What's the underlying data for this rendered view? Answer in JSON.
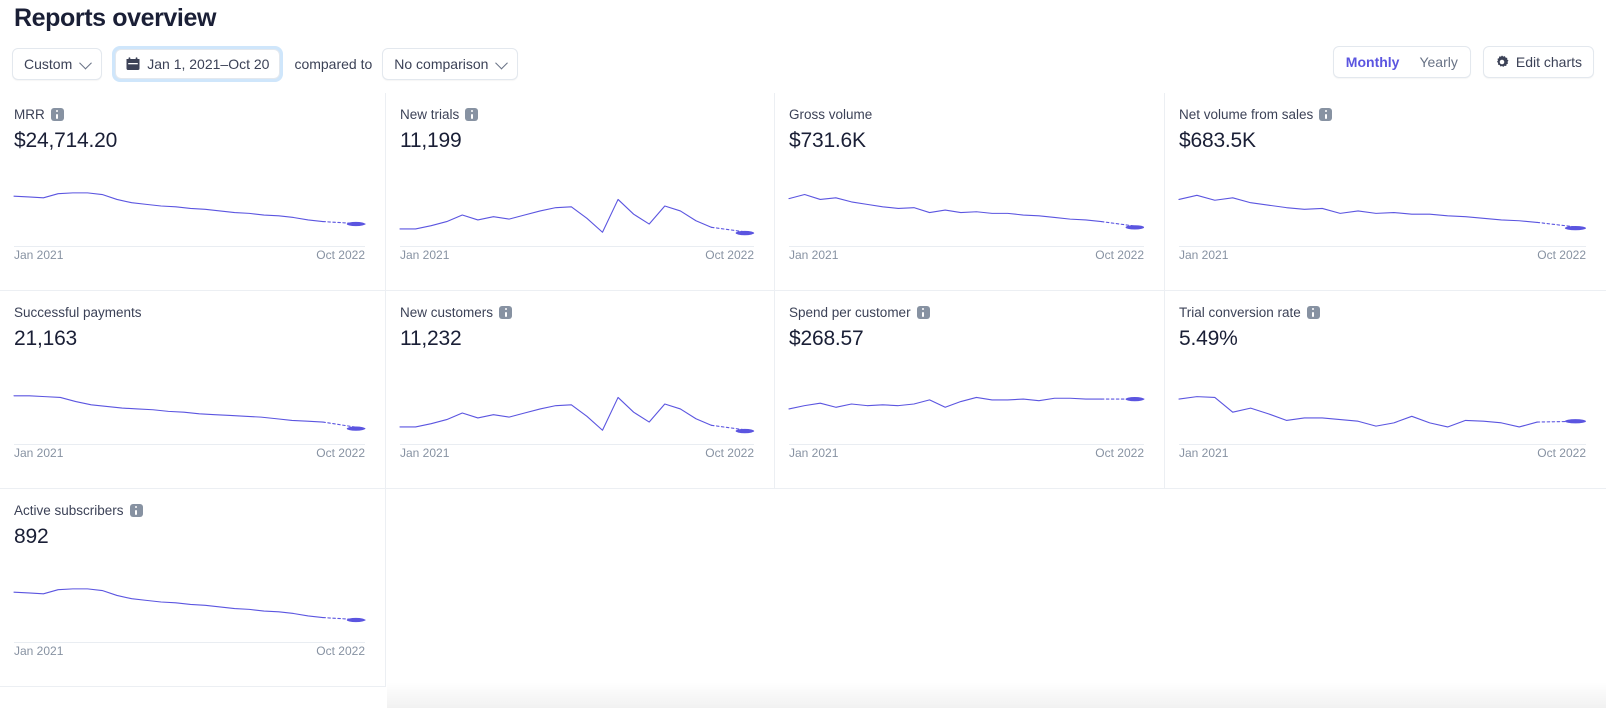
{
  "header": {
    "title": "Reports overview"
  },
  "toolbar": {
    "preset_label": "Custom",
    "date_range_label": "Jan 1, 2021–Oct 20",
    "calendar_icon": "calendar-icon",
    "compared_to_label": "compared to",
    "comparison_label": "No comparison",
    "interval_options": [
      {
        "label": "Monthly",
        "active": true
      },
      {
        "label": "Yearly",
        "active": false
      }
    ],
    "edit_charts_label": "Edit charts",
    "gear_icon": "gear-icon",
    "accent_color": "#5b55e0",
    "focus_ring_color": "#cfe6fb"
  },
  "chart_data": [
    {
      "type": "line",
      "title": "MRR",
      "value": "$24,714.20",
      "has_info": true,
      "xlabel_start": "Jan 2021",
      "xlabel_end": "Oct 2022",
      "color": "#5b55e0",
      "ylim": [
        0,
        100
      ],
      "values": [
        62,
        61,
        60,
        65,
        66,
        66,
        64,
        58,
        54,
        52,
        50,
        49,
        47,
        46,
        44,
        42,
        41,
        39,
        38,
        36,
        33,
        31
      ],
      "projected_values": [
        31,
        28
      ]
    },
    {
      "type": "line",
      "title": "New trials",
      "value": "11,199",
      "has_info": true,
      "xlabel_start": "Jan 2021",
      "xlabel_end": "Oct 2022",
      "color": "#5b55e0",
      "ylim": [
        0,
        100
      ],
      "values": [
        22,
        22,
        26,
        31,
        39,
        33,
        37,
        34,
        39,
        44,
        48,
        49,
        35,
        18,
        58,
        40,
        28,
        50,
        44,
        32,
        24
      ],
      "projected_values": [
        24,
        17
      ]
    },
    {
      "type": "line",
      "title": "Gross volume",
      "value": "$731.6K",
      "has_info": false,
      "xlabel_start": "Jan 2021",
      "xlabel_end": "Oct 2022",
      "color": "#5b55e0",
      "ylim": [
        0,
        100
      ],
      "values": [
        59,
        64,
        58,
        60,
        55,
        52,
        49,
        47,
        48,
        42,
        45,
        42,
        43,
        41,
        41,
        39,
        38,
        36,
        34,
        33,
        31
      ],
      "projected_values": [
        31,
        24
      ]
    },
    {
      "type": "line",
      "title": "Net volume from sales",
      "value": "$683.5K",
      "has_info": true,
      "xlabel_start": "Jan 2021",
      "xlabel_end": "Oct 2022",
      "color": "#5b55e0",
      "ylim": [
        0,
        100
      ],
      "values": [
        58,
        63,
        57,
        60,
        54,
        51,
        48,
        46,
        47,
        41,
        44,
        41,
        42,
        40,
        40,
        38,
        37,
        35,
        33,
        32,
        30
      ],
      "projected_values": [
        30,
        23
      ]
    },
    {
      "type": "line",
      "title": "Successful payments",
      "value": "21,163",
      "has_info": false,
      "xlabel_start": "Jan 2021",
      "xlabel_end": "Oct 2022",
      "color": "#5b55e0",
      "ylim": [
        0,
        100
      ],
      "values": [
        60,
        60,
        59,
        58,
        53,
        49,
        47,
        45,
        44,
        43,
        41,
        40,
        38,
        37,
        36,
        35,
        34,
        32,
        30,
        29,
        28
      ],
      "projected_values": [
        28,
        20
      ]
    },
    {
      "type": "line",
      "title": "New customers",
      "value": "11,232",
      "has_info": true,
      "xlabel_start": "Jan 2021",
      "xlabel_end": "Oct 2022",
      "color": "#5b55e0",
      "ylim": [
        0,
        100
      ],
      "values": [
        22,
        22,
        26,
        31,
        39,
        33,
        37,
        34,
        39,
        44,
        48,
        49,
        35,
        18,
        58,
        40,
        28,
        50,
        44,
        32,
        24
      ],
      "projected_values": [
        24,
        17
      ]
    },
    {
      "type": "line",
      "title": "Spend per customer",
      "value": "$268.57",
      "has_info": true,
      "xlabel_start": "Jan 2021",
      "xlabel_end": "Oct 2022",
      "color": "#5b55e0",
      "ylim": [
        0,
        100
      ],
      "values": [
        44,
        48,
        51,
        46,
        50,
        48,
        49,
        48,
        50,
        55,
        46,
        53,
        58,
        55,
        55,
        56,
        54,
        57,
        57,
        56,
        56
      ],
      "projected_values": [
        56,
        56
      ]
    },
    {
      "type": "line",
      "title": "Trial conversion rate",
      "value": "5.49%",
      "has_info": true,
      "xlabel_start": "Jan 2021",
      "xlabel_end": "Oct 2022",
      "color": "#5b55e0",
      "ylim": [
        0,
        100
      ],
      "values": [
        56,
        59,
        58,
        40,
        45,
        38,
        30,
        33,
        33,
        31,
        29,
        23,
        27,
        35,
        27,
        22,
        30,
        29,
        27,
        22,
        28
      ],
      "projected_values": [
        28,
        29
      ]
    },
    {
      "type": "line",
      "title": "Active subscribers",
      "value": "892",
      "has_info": true,
      "xlabel_start": "Jan 2021",
      "xlabel_end": "Oct 2022",
      "color": "#5b55e0",
      "ylim": [
        0,
        100
      ],
      "values": [
        62,
        61,
        60,
        65,
        66,
        66,
        64,
        58,
        54,
        52,
        50,
        49,
        47,
        46,
        44,
        42,
        41,
        39,
        38,
        36,
        33,
        31
      ],
      "projected_values": [
        31,
        28
      ]
    }
  ]
}
